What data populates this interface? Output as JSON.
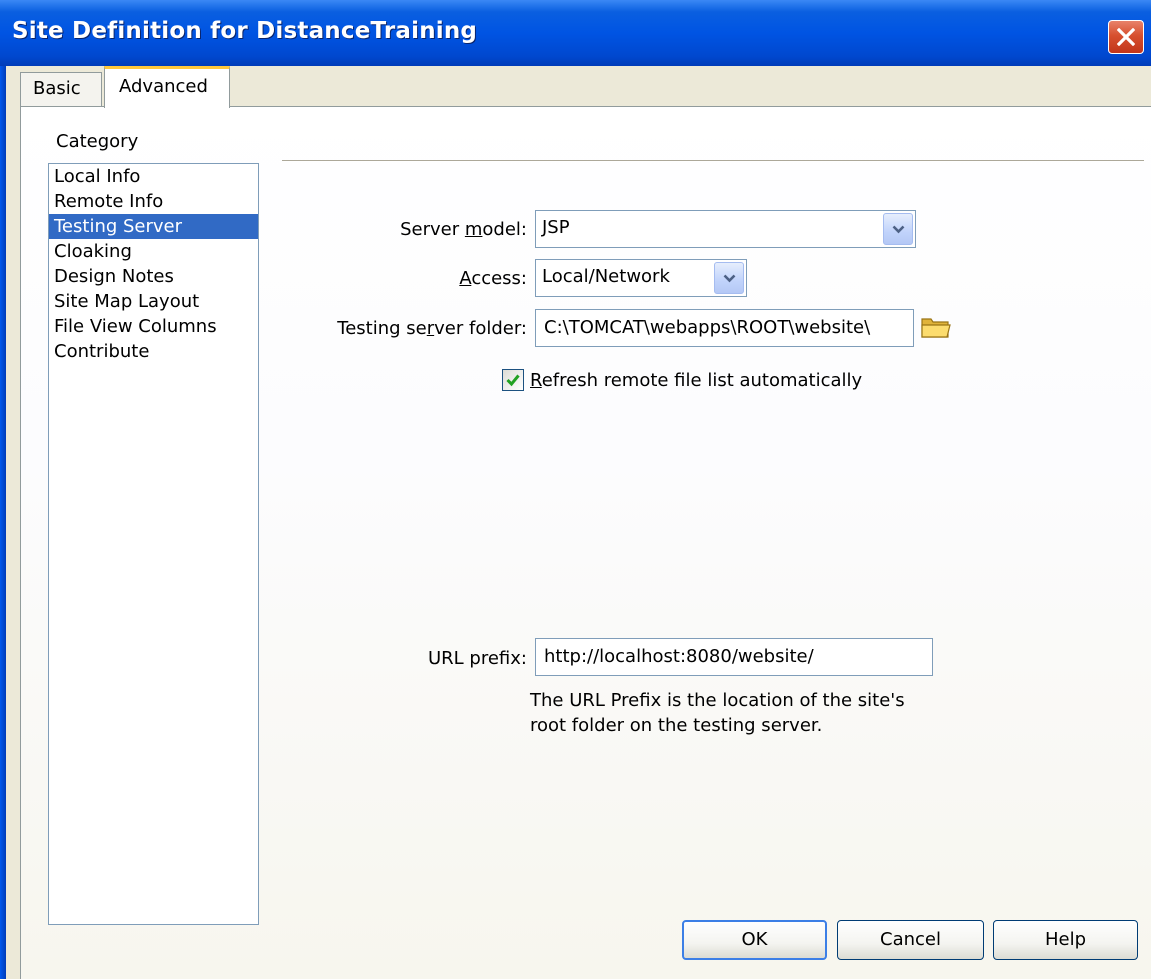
{
  "window": {
    "title": "Site Definition for DistanceTraining",
    "close_icon": "close-icon"
  },
  "tabs": [
    {
      "label": "Basic",
      "active": false
    },
    {
      "label": "Advanced",
      "active": true
    }
  ],
  "sidebar": {
    "heading": "Category",
    "items": [
      {
        "label": "Local Info",
        "selected": false
      },
      {
        "label": "Remote Info",
        "selected": false
      },
      {
        "label": "Testing Server",
        "selected": true
      },
      {
        "label": "Cloaking",
        "selected": false
      },
      {
        "label": "Design Notes",
        "selected": false
      },
      {
        "label": "Site Map Layout",
        "selected": false
      },
      {
        "label": "File View Columns",
        "selected": false
      },
      {
        "label": "Contribute",
        "selected": false
      }
    ]
  },
  "form": {
    "server_model": {
      "label_pre": "Server ",
      "label_key": "m",
      "label_post": "odel:",
      "value": "JSP"
    },
    "access": {
      "label_pre": "",
      "label_key": "A",
      "label_post": "ccess:",
      "value": "Local/Network"
    },
    "testing_folder": {
      "label_pre": "Testing se",
      "label_key": "r",
      "label_post": "ver folder:",
      "value": "C:\\TOMCAT\\webapps\\ROOT\\website\\",
      "browse_icon": "folder-icon"
    },
    "refresh": {
      "label_pre": "",
      "label_key": "R",
      "label_post": "efresh remote file list automatically",
      "checked": true
    },
    "url_prefix": {
      "label": "URL prefix:",
      "value": "http://localhost:8080/website/"
    },
    "hint_line1": "The URL Prefix is the location of the site's",
    "hint_line2": "root folder on the testing server."
  },
  "buttons": {
    "ok": "OK",
    "cancel": "Cancel",
    "help": "Help"
  },
  "colors": {
    "titlebar": "#0054e3",
    "selection": "#316ac5",
    "tab_accent": "#ffc83c"
  }
}
